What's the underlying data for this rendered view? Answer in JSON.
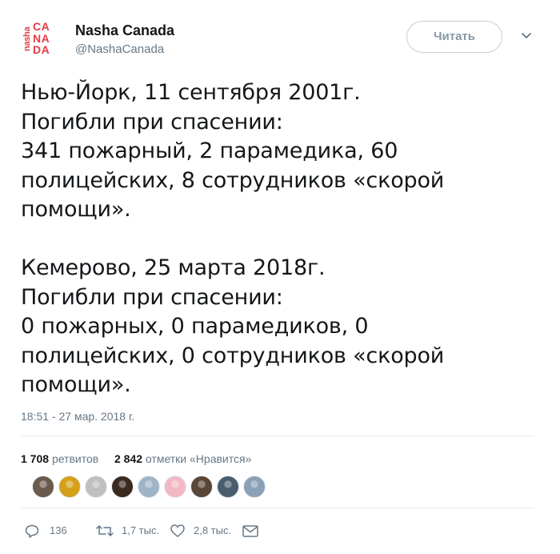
{
  "account": {
    "logo_side": "nasha",
    "logo_lines": [
      "CA",
      "NA",
      "DA"
    ],
    "display_name": "Nasha Canada",
    "handle": "@NashaCanada",
    "follow_label": "Читать"
  },
  "tweet": {
    "text": "Нью-Йорк, 11 сентября 2001г.\nПогибли при спасении:\n341 пожарный, 2 парамедика, 60\nполицейских, 8 сотрудников «скорой\nпомощи».\n\nКемерово, 25 марта 2018г.\nПогибли при спасении:\n0 пожарных, 0 парамедиков, 0\nполицейских, 0 сотрудников «скорой\nпомощи».",
    "timestamp": "18:51 - 27 мар. 2018 г."
  },
  "stats": {
    "retweets_count": "1 708",
    "retweets_label": "ретвитов",
    "likes_count": "2 842",
    "likes_label": "отметки «Нравится»"
  },
  "avatars": [
    {
      "name": "avatar-1",
      "color": "#6b5a4e"
    },
    {
      "name": "avatar-2",
      "color": "#d4a017"
    },
    {
      "name": "avatar-3",
      "color": "#bfbfbf"
    },
    {
      "name": "avatar-4",
      "color": "#3b2a20"
    },
    {
      "name": "avatar-5",
      "color": "#9fb4c7"
    },
    {
      "name": "avatar-6",
      "color": "#f2b8c6"
    },
    {
      "name": "avatar-7",
      "color": "#5a4636"
    },
    {
      "name": "avatar-8",
      "color": "#4a5d6e"
    },
    {
      "name": "avatar-9",
      "color": "#8aa0b5"
    }
  ],
  "actions": {
    "replies": "136",
    "retweets": "1,7 тыс.",
    "likes": "2,8 тыс."
  },
  "colors": {
    "brand_red": "#e63946",
    "text_primary": "#14171a",
    "text_secondary": "#657786"
  },
  "icons": [
    "chevron-down-icon",
    "reply-icon",
    "retweet-icon",
    "heart-icon",
    "mail-icon"
  ]
}
